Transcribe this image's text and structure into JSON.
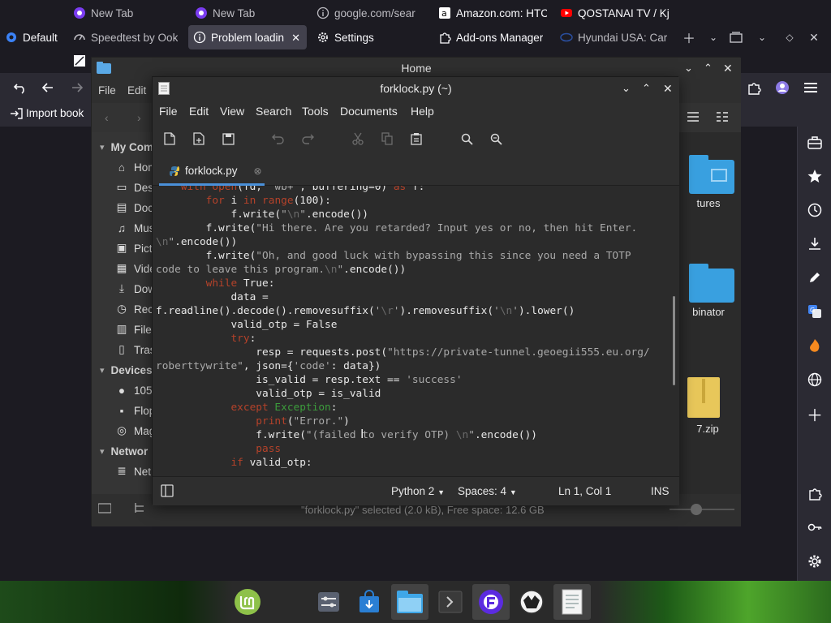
{
  "firefox": {
    "tabs_row1": [
      {
        "label": "New Tab",
        "favicon": "firefox-icon"
      },
      {
        "label": "New Tab",
        "favicon": "firefox-icon"
      },
      {
        "label": "google.com/sear",
        "favicon": "info-icon"
      },
      {
        "label": "Amazon.com: HTC",
        "favicon": "amazon-icon"
      },
      {
        "label": "QOSTANAI TV / Kj",
        "favicon": "youtube-icon"
      }
    ],
    "tabs_row2": [
      {
        "label": "Default",
        "favicon": "container-icon"
      },
      {
        "label": "Speedtest by Ook",
        "favicon": "speedtest-icon"
      },
      {
        "label": "Problem loadin",
        "favicon": "info-icon",
        "active": true
      },
      {
        "label": "Settings",
        "favicon": "gear-icon"
      },
      {
        "label": "Add-ons Manager",
        "favicon": "puzzle-icon"
      },
      {
        "label": "Hyundai USA: Car",
        "favicon": "hyundai-icon"
      }
    ],
    "tab_row3_partial": "A",
    "import_bookmarks": "Import book",
    "accent": "#e22850"
  },
  "nemo": {
    "title": "Home",
    "menu": [
      "File",
      "Edit"
    ],
    "sidebar": [
      {
        "label": "My Com",
        "type": "header"
      },
      {
        "label": "Hom",
        "icon": "home-icon"
      },
      {
        "label": "Des",
        "icon": "desktop-icon"
      },
      {
        "label": "Doc",
        "icon": "document-icon"
      },
      {
        "label": "Mus",
        "icon": "music-icon"
      },
      {
        "label": "Pict",
        "icon": "picture-icon"
      },
      {
        "label": "Vide",
        "icon": "video-icon"
      },
      {
        "label": "Dow",
        "icon": "download-icon"
      },
      {
        "label": "Rec",
        "icon": "recent-icon"
      },
      {
        "label": "File",
        "icon": "filesystem-icon"
      },
      {
        "label": "Tras",
        "icon": "trash-icon"
      },
      {
        "label": "Devices",
        "type": "header"
      },
      {
        "label": "105",
        "icon": "drive-icon"
      },
      {
        "label": "Flop",
        "icon": "floppy-icon"
      },
      {
        "label": "Mag",
        "icon": "disc-icon"
      },
      {
        "label": "Networ",
        "type": "header"
      },
      {
        "label": "Net",
        "icon": "network-icon"
      }
    ],
    "items": [
      {
        "label": "tures",
        "icon": "pictures-folder-icon"
      },
      {
        "label": "binator",
        "icon": "folder-icon"
      },
      {
        "label": "7.zip",
        "icon": "zip-icon"
      }
    ],
    "status": "\"forklock.py\" selected (2.0 kB), Free space: 12.6 GB"
  },
  "gedit": {
    "title": "forklock.py (~)",
    "menu": [
      "File",
      "Edit",
      "View",
      "Search",
      "Tools",
      "Documents",
      "Help"
    ],
    "tab_label": "forklock.py",
    "status": {
      "language": "Python 2",
      "spaces": "Spaces: 4",
      "position": "Ln 1, Col 1",
      "mode": "INS"
    },
    "code_lines": [
      [
        [
          "    ",
          ""
        ],
        [
          "with ",
          "kw"
        ],
        [
          "open",
          "fn"
        ],
        [
          "(fd, ",
          ""
        ],
        [
          "\"wb+\"",
          "str"
        ],
        [
          ", buffering=0) ",
          ""
        ],
        [
          "as",
          "kw"
        ],
        [
          " f:",
          ""
        ]
      ],
      [
        [
          "        ",
          ""
        ],
        [
          "for",
          "kw"
        ],
        [
          " i ",
          ""
        ],
        [
          "in",
          "kw"
        ],
        [
          " ",
          ""
        ],
        [
          "range",
          "fn"
        ],
        [
          "(100):",
          ""
        ]
      ],
      [
        [
          "            f.write(",
          ""
        ],
        [
          "\"",
          "str"
        ],
        [
          "\\n",
          "esc"
        ],
        [
          "\"",
          "str"
        ],
        [
          ".encode())",
          ""
        ]
      ],
      [
        [
          "        f.write(",
          ""
        ],
        [
          "\"Hi there. Are you retarded? Input yes or no, then hit Enter.",
          "str"
        ]
      ],
      [
        [
          "\\n",
          "esc"
        ],
        [
          "\"",
          "str"
        ],
        [
          ".encode())",
          ""
        ]
      ],
      [
        [
          "        f.write(",
          ""
        ],
        [
          "\"Oh, and good luck with bypassing this since you need a TOTP",
          "str"
        ]
      ],
      [
        [
          "code to leave this program.",
          "str"
        ],
        [
          "\\n",
          "esc"
        ],
        [
          "\"",
          "str"
        ],
        [
          ".encode())",
          ""
        ]
      ],
      [
        [
          "        ",
          ""
        ],
        [
          "while",
          "kw"
        ],
        [
          " True:",
          ""
        ]
      ],
      [
        [
          "            data =",
          ""
        ]
      ],
      [
        [
          "f.readline().decode().removesuffix(",
          ""
        ],
        [
          "'",
          "str"
        ],
        [
          "\\r",
          "esc"
        ],
        [
          "'",
          "str"
        ],
        [
          ").removesuffix(",
          ""
        ],
        [
          "'",
          "str"
        ],
        [
          "\\n",
          "esc"
        ],
        [
          "'",
          "str"
        ],
        [
          ").lower()",
          ""
        ]
      ],
      [
        [
          "            valid_otp = False",
          ""
        ]
      ],
      [
        [
          "            ",
          ""
        ],
        [
          "try",
          "kw"
        ],
        [
          ":",
          ""
        ]
      ],
      [
        [
          "                resp = requests.post(",
          ""
        ],
        [
          "\"https://private-tunnel.geoegii555.eu.org/",
          "str"
        ]
      ],
      [
        [
          "roberttywrite\"",
          "str"
        ],
        [
          ", json={",
          ""
        ],
        [
          "'code'",
          "str"
        ],
        [
          ": data})",
          ""
        ]
      ],
      [
        [
          "                is_valid = resp.text == ",
          ""
        ],
        [
          "'success'",
          "str"
        ]
      ],
      [
        [
          "                valid_otp = is_valid",
          ""
        ]
      ],
      [
        [
          "            ",
          ""
        ],
        [
          "except",
          "kw"
        ],
        [
          " ",
          ""
        ],
        [
          "Exception",
          "cls"
        ],
        [
          ":",
          ""
        ]
      ],
      [
        [
          "                ",
          ""
        ],
        [
          "print",
          "fn"
        ],
        [
          "(",
          ""
        ],
        [
          "\"Error.\"",
          "str"
        ],
        [
          ")",
          ""
        ]
      ],
      [
        [
          "                f.write(",
          ""
        ],
        [
          "\"(failed to verify OTP) ",
          "str"
        ],
        [
          "\\n",
          "esc"
        ],
        [
          "\"",
          "str"
        ],
        [
          ".encode())",
          ""
        ]
      ],
      [
        [
          "                ",
          ""
        ],
        [
          "pass",
          "kw"
        ]
      ],
      [
        [
          "            ",
          ""
        ],
        [
          "if",
          "kw"
        ],
        [
          " valid_otp:",
          ""
        ]
      ]
    ]
  },
  "taskbar": {
    "apps": [
      "mint-menu-icon",
      "settings-icon",
      "store-icon",
      "files-icon",
      "terminal-icon",
      "firefox-icon",
      "game-icon",
      "editor-icon"
    ]
  }
}
